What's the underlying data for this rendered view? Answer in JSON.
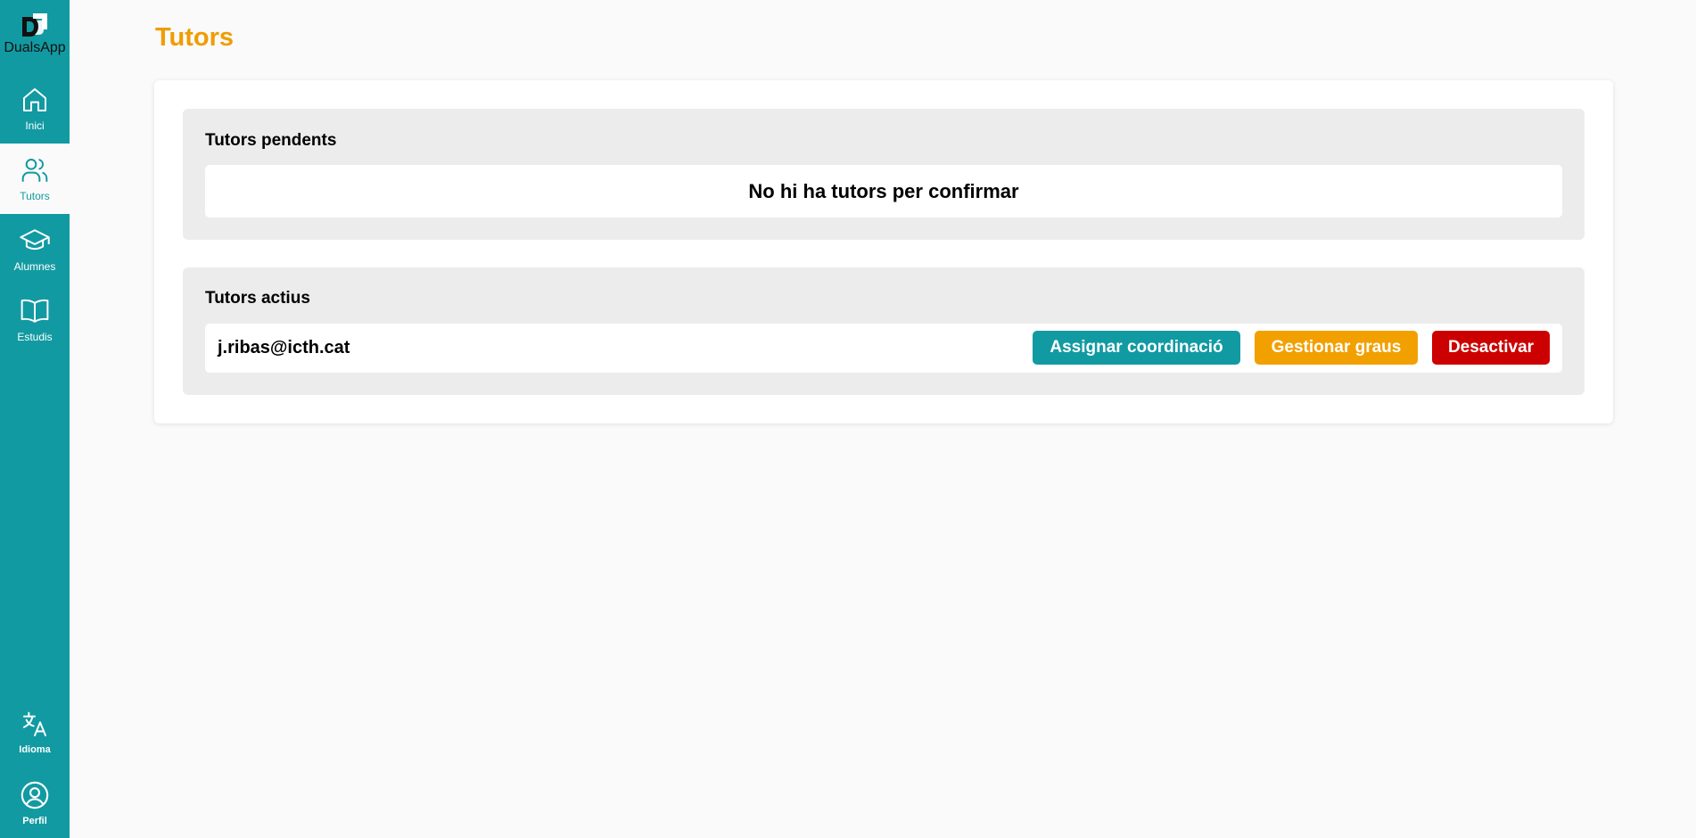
{
  "app": {
    "name": "DualsApp"
  },
  "sidebar": {
    "items": [
      {
        "label": "Inici",
        "icon": "home-icon"
      },
      {
        "label": "Tutors",
        "icon": "users-icon",
        "active": true
      },
      {
        "label": "Alumnes",
        "icon": "graduation-cap-icon"
      },
      {
        "label": "Estudis",
        "icon": "book-icon"
      }
    ],
    "bottom_items": [
      {
        "label": "Idioma",
        "icon": "translate-icon"
      },
      {
        "label": "Perfil",
        "icon": "user-circle-icon"
      }
    ]
  },
  "page": {
    "title": "Tutors"
  },
  "pending": {
    "title": "Tutors pendents",
    "empty_message": "No hi ha tutors per confirmar"
  },
  "active": {
    "title": "Tutors actius",
    "tutors": [
      {
        "email": "j.ribas@icth.cat",
        "assign_label": "Assignar coordinació",
        "grades_label": "Gestionar graus",
        "deactivate_label": "Desactivar"
      }
    ]
  },
  "colors": {
    "sidebar": "#129aa2",
    "accent_orange": "#f09c00",
    "danger": "#cc0000"
  }
}
